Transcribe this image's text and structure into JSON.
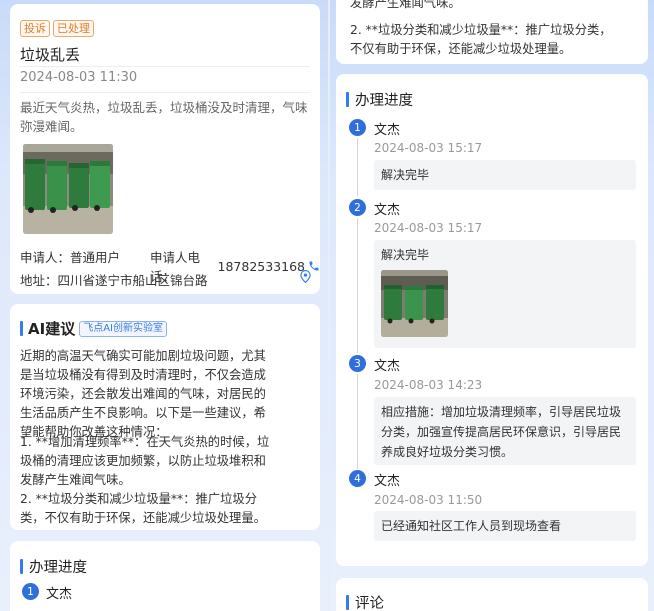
{
  "complaint": {
    "badges": [
      "投诉",
      "已处理"
    ],
    "title": "垃圾乱丢",
    "time": "2024-08-03 11:30",
    "description": "最近天气炎热，垃圾乱丢，垃圾桶没及时清理，气味弥漫难闻。",
    "applicant_label": "申请人：",
    "applicant": "普通用户",
    "phone_label": "申请人电话：",
    "phone": "18782533168",
    "address_label": "地址：",
    "address": "四川省遂宁市船山区锦台路"
  },
  "ai": {
    "title": "AI建议",
    "tag": "飞点AI创新实验室",
    "intro": "近期的高温天气确实可能加剧垃圾问题，尤其是当垃圾桶没有得到及时清理时，不仅会造成环境污染，还会散发出难闻的气味，对居民的生活品质产生不良影响。以下是一些建议，希望能帮助你改善这种情况：",
    "point1": "1. **增加清理频率**：在天气炎热的时候，垃圾桶的清理应该更加频繁，以防止垃圾堆积和发酵产生难闻气味。",
    "point2": "2. **垃圾分类和减少垃圾量**：推广垃圾分类，不仅有助于环保，还能减少垃圾处理量。",
    "top_cut_line": "发酵产生难闻气味。"
  },
  "progress": {
    "title": "办理进度",
    "steps": [
      {
        "num": "1",
        "name": "文杰",
        "time": "2024-08-03 15:17",
        "text": "解决完毕"
      },
      {
        "num": "2",
        "name": "文杰",
        "time": "2024-08-03 15:17",
        "text": "解决完毕"
      },
      {
        "num": "3",
        "name": "文杰",
        "time": "2024-08-03 14:23",
        "text": "相应措施：增加垃圾清理频率，引导居民垃圾分类，加强宣传提高居民环保意识，引导居民养成良好垃圾分类习惯。"
      },
      {
        "num": "4",
        "name": "文杰",
        "time": "2024-08-03 11:50",
        "text": "已经通知社区工作人员到现场查看"
      }
    ]
  },
  "comments": {
    "title": "评论"
  },
  "icons": {
    "phone": "phone-icon",
    "location": "location-pin-icon"
  },
  "colors": {
    "accent": "#2f6fdb",
    "badge": "#e07b2a"
  }
}
